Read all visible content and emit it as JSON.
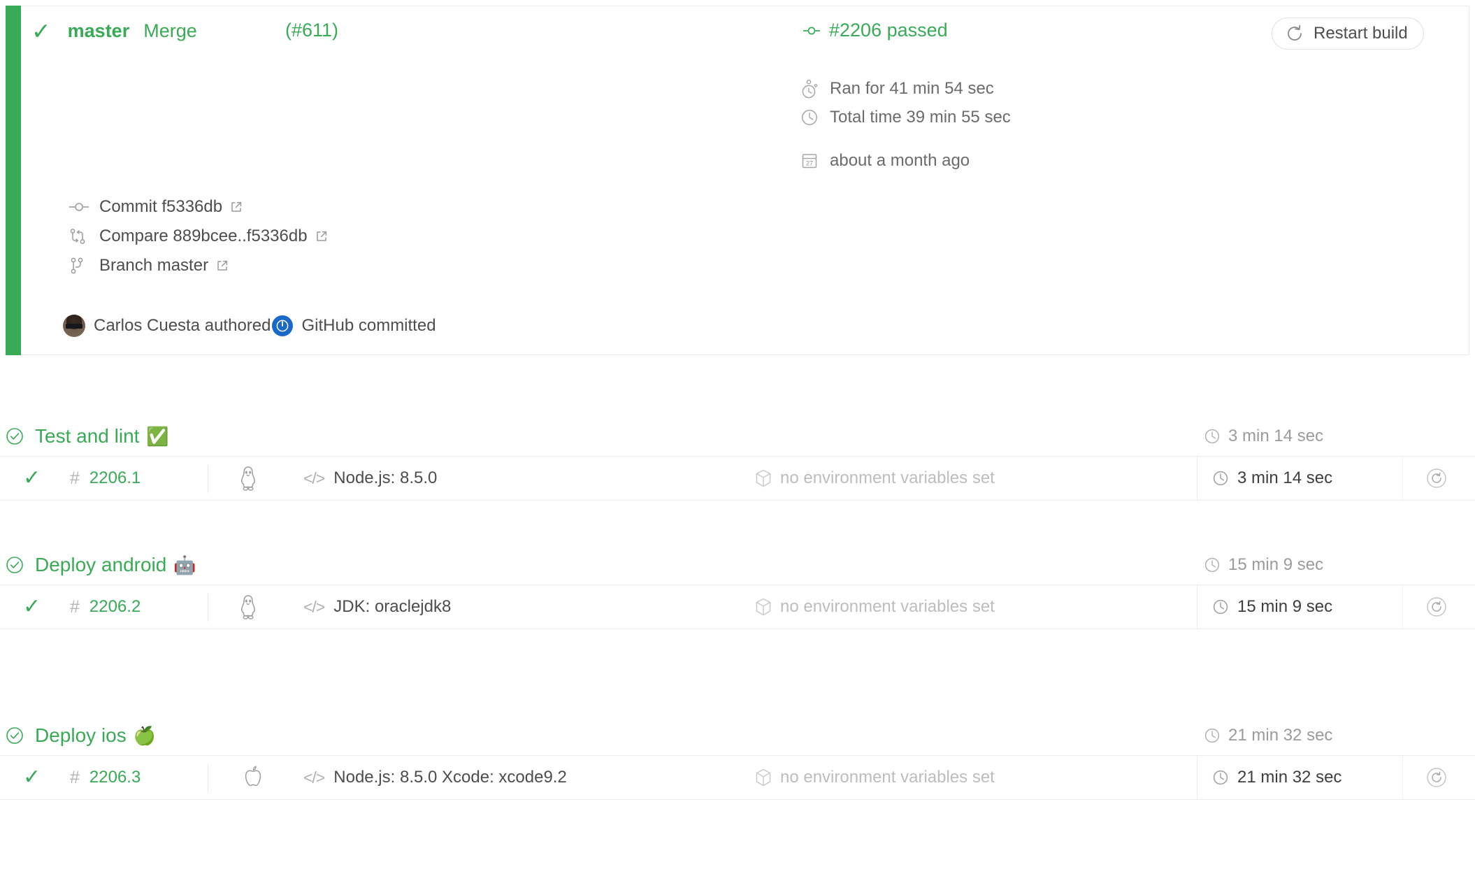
{
  "build": {
    "status_icon": "check-icon",
    "status_color": "#39aa56",
    "branch": "master",
    "commit_subject": "Merge",
    "pull_request": "(#611)",
    "build_number_label": "#2206 passed",
    "restart_button_label": "Restart build",
    "meta": [
      {
        "icon": "stopwatch-icon",
        "label": "Ran for 41 min 54 sec"
      },
      {
        "icon": "clock-icon",
        "label": "Total time 39 min 55 sec"
      },
      {
        "icon": "calendar-icon",
        "label": "about a month ago",
        "calendar_day": "27"
      }
    ],
    "links": [
      {
        "icon": "commit-icon",
        "label": "Commit f5336db"
      },
      {
        "icon": "compare-icon",
        "label": "Compare 889bcee..f5336db"
      },
      {
        "icon": "branch-icon",
        "label": "Branch master"
      }
    ],
    "author": {
      "avatar": "user-avatar",
      "authored_label": "Carlos Cuesta authored",
      "committer_badge": "github-power-icon",
      "committed_label": "GitHub committed"
    }
  },
  "groups": [
    {
      "status_icon": "check-circle-icon",
      "title": "Test and lint",
      "emoji": "✅",
      "duration": "3 min 14 sec",
      "jobs": [
        {
          "status_icon": "check-icon",
          "number": "2206.1",
          "os_icon": "linux-penguin-icon",
          "config": "Node.js: 8.5.0",
          "env": "no environment variables set",
          "duration": "3 min 14 sec",
          "restart_icon": "restart-circle-icon"
        }
      ]
    },
    {
      "status_icon": "check-circle-icon",
      "title": "Deploy android",
      "emoji": "🤖",
      "duration": "15 min 9 sec",
      "jobs": [
        {
          "status_icon": "check-icon",
          "number": "2206.2",
          "os_icon": "linux-penguin-icon",
          "config": "JDK: oraclejdk8",
          "env": "no environment variables set",
          "duration": "15 min 9 sec",
          "restart_icon": "restart-circle-icon"
        }
      ]
    },
    {
      "status_icon": "check-circle-icon",
      "title": "Deploy ios",
      "emoji": "🍏",
      "duration": "21 min 32 sec",
      "jobs": [
        {
          "status_icon": "check-icon",
          "number": "2206.3",
          "os_icon": "apple-icon",
          "config": "Node.js: 8.5.0 Xcode: xcode9.2",
          "env": "no environment variables set",
          "duration": "21 min 32 sec",
          "restart_icon": "restart-circle-icon"
        }
      ]
    }
  ],
  "colors": {
    "pass_green": "#39aa56",
    "text_dark": "#3e3e3e",
    "text_muted": "#9b9b9b",
    "text_faint": "#bdbdbd",
    "border": "#ececec",
    "github_blue": "#1a69c9"
  }
}
